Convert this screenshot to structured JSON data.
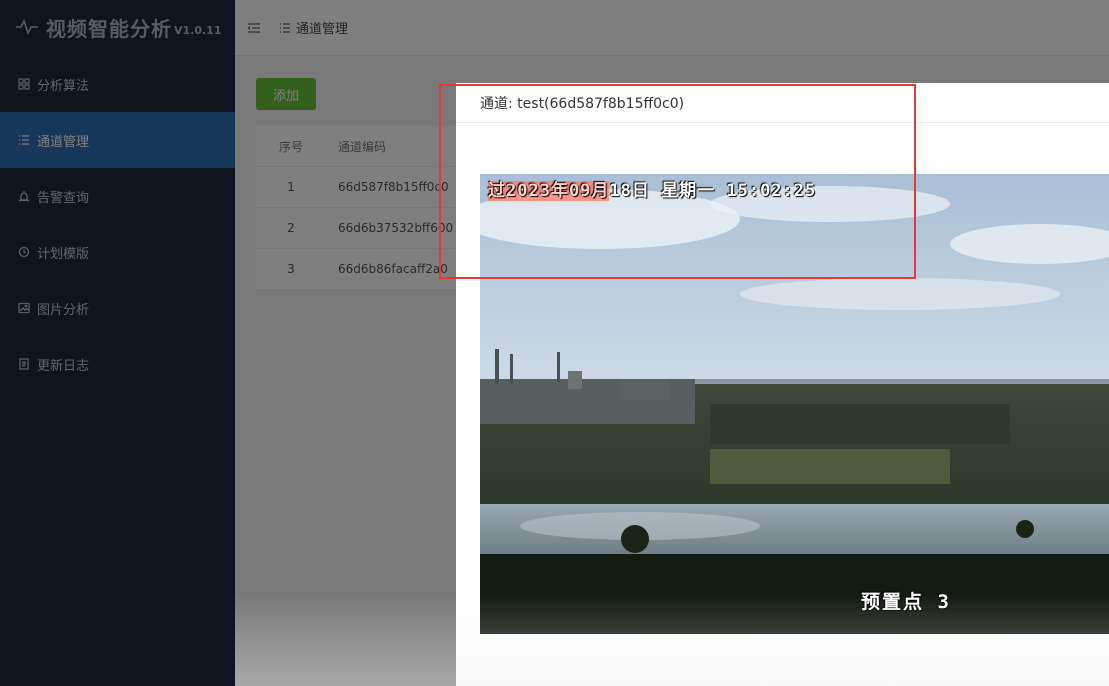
{
  "app": {
    "title": "视频智能分析",
    "version": "V1.0.11"
  },
  "sidebar": {
    "items": [
      {
        "label": "分析算法",
        "icon": "grid-icon",
        "active": false
      },
      {
        "label": "通道管理",
        "icon": "list-icon",
        "active": true
      },
      {
        "label": "告警查询",
        "icon": "alarm-icon",
        "active": false
      },
      {
        "label": "计划模版",
        "icon": "clock-icon",
        "active": false
      },
      {
        "label": "图片分析",
        "icon": "image-icon",
        "active": false
      },
      {
        "label": "更新日志",
        "icon": "document-icon",
        "active": false
      }
    ]
  },
  "header": {
    "breadcrumb": "通道管理"
  },
  "toolbar": {
    "add_label": "添加"
  },
  "table": {
    "columns": [
      "序号",
      "通道编码"
    ],
    "rows": [
      [
        "1",
        "66d587f8b15ff0c0"
      ],
      [
        "2",
        "66d6b37532bff600"
      ],
      [
        "3",
        "66d6b86facaff2a0"
      ]
    ]
  },
  "dialog": {
    "title": "通道: test(66d587f8b15ff0c0)"
  },
  "video": {
    "timestamp_overlay": "过2023年09月",
    "timestamp_rest": "18日 星期一 15:02:25",
    "preset_label": "预置点 3"
  },
  "colors": {
    "sidebar_bg": "#1e2a3c",
    "active_item": "#2d6fb5",
    "add_button": "#67c23a",
    "annotation_box": "#e53935"
  }
}
